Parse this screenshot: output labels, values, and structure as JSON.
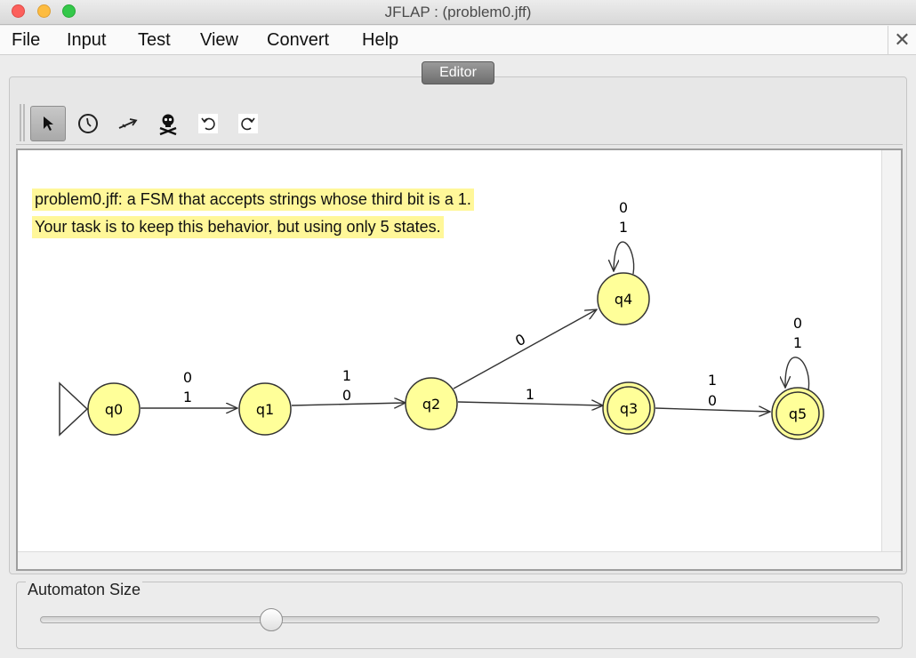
{
  "window": {
    "title": "JFLAP : (problem0.jff)"
  },
  "menu": {
    "items": [
      "File",
      "Input",
      "Test",
      "View",
      "Convert",
      "Help"
    ],
    "close_glyph": "✕"
  },
  "tabs": {
    "active": "Editor"
  },
  "toolbar": {
    "tools": [
      {
        "name": "attribute-editor",
        "icon": "arrow-pointer-icon",
        "active": true
      },
      {
        "name": "state-creator",
        "icon": "state-circle-icon",
        "active": false
      },
      {
        "name": "transition-creator",
        "icon": "transition-arrow-icon",
        "active": false
      },
      {
        "name": "deleter",
        "icon": "skull-icon",
        "active": false
      },
      {
        "name": "undo",
        "icon": "undo-icon",
        "active": false
      },
      {
        "name": "redo",
        "icon": "redo-icon",
        "active": false
      }
    ]
  },
  "canvas": {
    "note_line1": "problem0.jff: a FSM that accepts strings whose third bit is a 1.",
    "note_line2": "Your task is to keep this behavior, but using only 5 states.",
    "states": {
      "q0": {
        "label": "q0",
        "initial": true,
        "final": false
      },
      "q1": {
        "label": "q1",
        "initial": false,
        "final": false
      },
      "q2": {
        "label": "q2",
        "initial": false,
        "final": false
      },
      "q3": {
        "label": "q3",
        "initial": false,
        "final": true
      },
      "q4": {
        "label": "q4",
        "initial": false,
        "final": false
      },
      "q5": {
        "label": "q5",
        "initial": false,
        "final": true
      }
    },
    "transitions": {
      "q0_q1": {
        "from": "q0",
        "to": "q1",
        "labels": [
          "0",
          "1"
        ]
      },
      "q1_q2": {
        "from": "q1",
        "to": "q2",
        "labels": [
          "1",
          "0"
        ]
      },
      "q2_q4": {
        "from": "q2",
        "to": "q4",
        "labels": [
          "0"
        ]
      },
      "q2_q3": {
        "from": "q2",
        "to": "q3",
        "labels": [
          "1"
        ]
      },
      "q3_q5": {
        "from": "q3",
        "to": "q5",
        "labels": [
          "1",
          "0"
        ]
      },
      "q4_q4": {
        "from": "q4",
        "to": "q4",
        "labels": [
          "0",
          "1"
        ]
      },
      "q5_q5": {
        "from": "q5",
        "to": "q5",
        "labels": [
          "0",
          "1"
        ]
      }
    },
    "state_fill": "#ffff99"
  },
  "size_panel": {
    "title": "Automaton Size",
    "slider_level": 0.27
  }
}
